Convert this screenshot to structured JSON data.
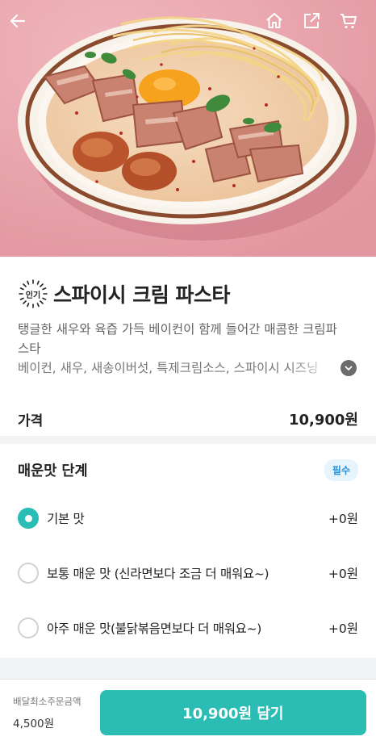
{
  "header": {
    "back_icon": "arrow-left-icon",
    "home_icon": "home-icon",
    "share_icon": "share-icon",
    "cart_icon": "cart-icon"
  },
  "product": {
    "badge": "인기",
    "title": "스파이시 크림 파스타",
    "description": "탱글한 새우와 육즙 가득 베이컨이 함께 들어간 매콤한 크림파스타",
    "ingredients": "베이컨, 새우, 새송이버섯, 특제크림소스, 스파이시 시즈닝",
    "price_label": "가격",
    "price_value": "10,900원"
  },
  "options": {
    "title": "매운맛 단계",
    "required_badge": "필수",
    "items": [
      {
        "label": "기본 맛",
        "price": "+0원",
        "selected": true
      },
      {
        "label": "보통 매운 맛 (신라면보다 조금 더 매워요~)",
        "price": "+0원",
        "selected": false
      },
      {
        "label": "아주 매운 맛(불닭볶음면보다 더 매워요~)",
        "price": "+0원",
        "selected": false
      }
    ]
  },
  "footer": {
    "min_order_label": "배달최소주문금액",
    "min_order_value": "4,500원",
    "add_button_label": "10,900원 담기"
  },
  "colors": {
    "accent": "#2bbdb4",
    "hero_background": "#e9a8ae",
    "required_badge_text": "#2a8fd6"
  }
}
